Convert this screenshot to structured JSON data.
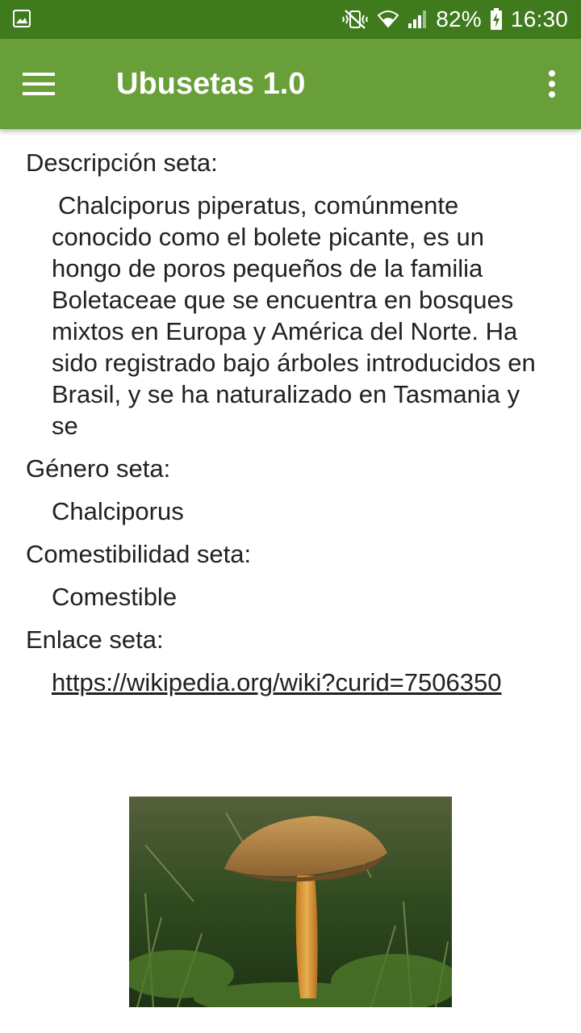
{
  "status_bar": {
    "battery": "82%",
    "time": "16:30"
  },
  "app_bar": {
    "title": "Ubusetas 1.0"
  },
  "details": {
    "description_label": "Descripción seta:",
    "description_text": "Chalciporus piperatus, comúnmente conocido como el bolete picante, es un hongo de poros pequeños de la familia Boletaceae que se encuentra en bosques mixtos en Europa y América del Norte. Ha sido registrado bajo árboles introducidos en Brasil, y se ha naturalizado en Tasmania y se",
    "genus_label": "Género seta:",
    "genus_value": "Chalciporus",
    "edibility_label": "Comestibilidad seta:",
    "edibility_value": "Comestible",
    "link_label": "Enlace seta:",
    "link_value": "https://wikipedia.org/wiki?curid=7506350"
  },
  "colors": {
    "status_bar": "#3f7a1c",
    "app_bar": "#689f38"
  }
}
